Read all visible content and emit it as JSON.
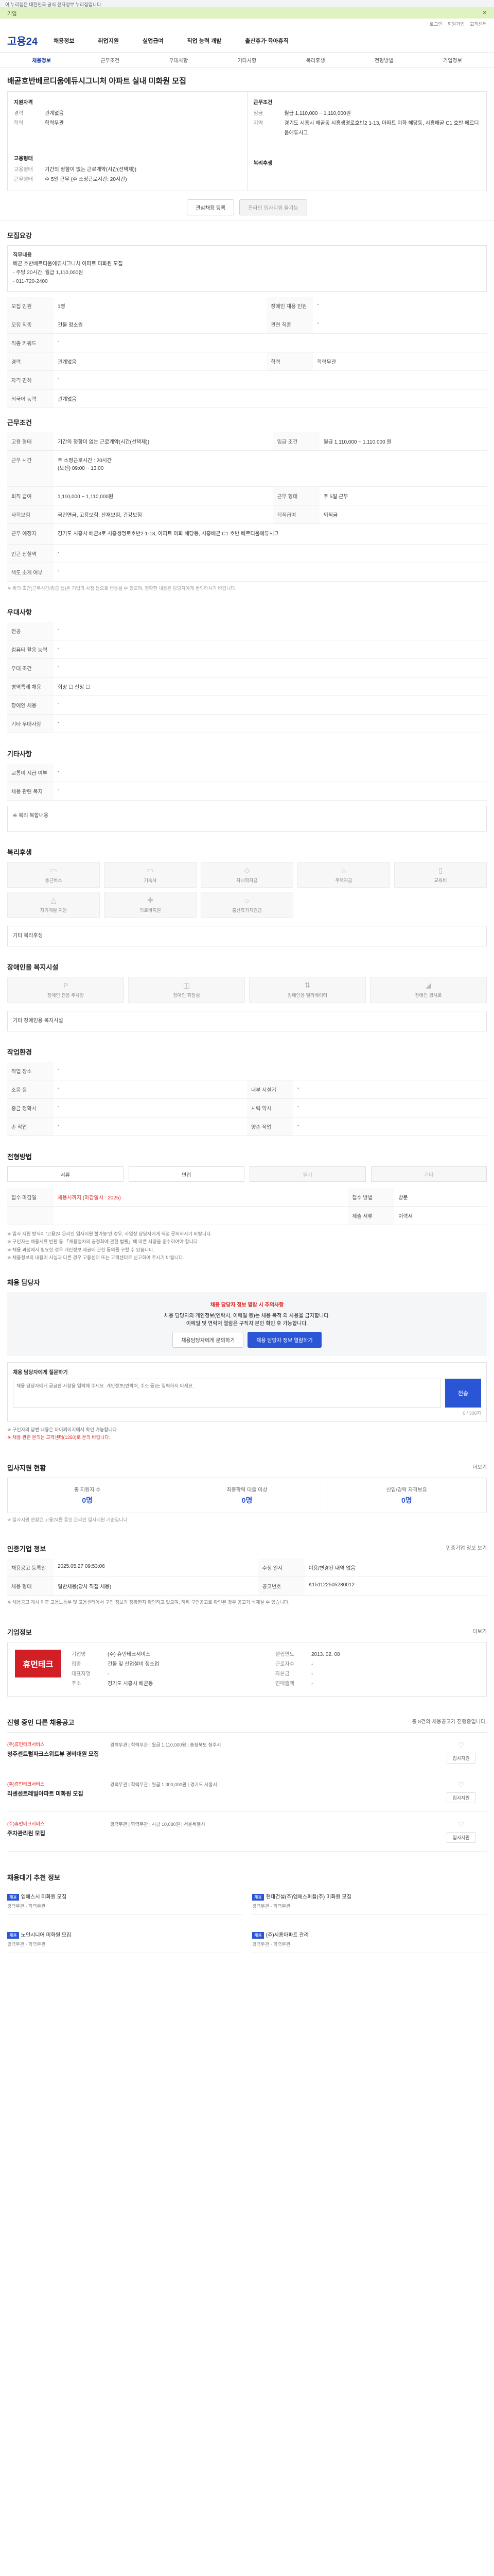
{
  "topbar": "이 누리집은 대한민국 공식 전자정부 누리집입니다.",
  "banner": {
    "text": "기업",
    "close": "✕"
  },
  "util": [
    "로그인",
    "회원가입",
    "고객센터"
  ],
  "header": {
    "logo": "고용24",
    "nav": [
      "채용정보",
      "취업지원",
      "실업급여",
      "직업 능력 개발",
      "출산휴가·육아휴직"
    ]
  },
  "subnav": [
    "채용정보",
    "근무조건",
    "우대사항",
    "기타사항",
    "복리후생",
    "전형방법",
    "기업정보"
  ],
  "job": {
    "title": "배곧호반베르디움에듀시그니처 아파트 실내 미화원 모집",
    "summary_left_title": "지원자격",
    "summary_left": [
      {
        "k": "경력",
        "v": "관계없음"
      },
      {
        "k": "학력",
        "v": "학력무관"
      }
    ],
    "summary_left2_title": "고용형태",
    "summary_left2": [
      {
        "k": "고용형태",
        "v": "기간의 정함이 없는 근로계약(시간(선택제))"
      },
      {
        "k": "근무형태",
        "v": "주 5일 근무 (주 소정근로시간: 20시간)"
      }
    ],
    "summary_right_title": "근무조건",
    "summary_right": [
      {
        "k": "임금",
        "v": "월급 1,110,000 ~ 1,110,000원"
      },
      {
        "k": "지역",
        "v": "경기도 시흥시 배곧동 시흥생명로호반2 1-13, 아파트 미화 해당동, 시흥배곧 C1 호반 베르디움에듀시그"
      },
      {
        "k": "",
        "v": ""
      }
    ],
    "summary_right2_title": "복리후생",
    "buttons": {
      "apply": "온라인 입사지원 불가능",
      "save": "관심채용 등록"
    }
  },
  "recruit": {
    "title": "모집요강",
    "desc_title": "직무내용",
    "desc": "배곧 호반베르디움에듀시그니처 아파트 미화원 모집\n- 주당 20시간, 월급 1,110,000원\n- 011-720-2400",
    "rows": [
      {
        "h": "모집 인원",
        "v": "1명",
        "h2": "장애인 채용 인원",
        "v2": "-"
      },
      {
        "h": "모집 직종",
        "v": "건물 청소원",
        "h2": "관련 직종",
        "v2": "-"
      },
      {
        "h": "직종 키워드",
        "v": "-",
        "h2": "",
        "v2": ""
      },
      {
        "h": "경력",
        "v": "관계없음",
        "h2": "학력",
        "v2": "학력무관"
      },
      {
        "h": "자격 면허",
        "v": "-",
        "h2": "",
        "v2": ""
      },
      {
        "h": "외국어 능력",
        "v": "관계없음",
        "h2": "",
        "v2": ""
      }
    ]
  },
  "conditions": {
    "title": "근무조건",
    "rows": [
      {
        "h": "고용 형태",
        "v": "기간의 정함이 없는 근로계약(시간(선택제))",
        "h2": "임금 조건",
        "v2": "월급 1,110,000 ~ 1,110,000 원"
      },
      {
        "h": "근무 시간",
        "v": "주 소정근로시간 : 20시간\n(오전) 09:00 ~ 13:00",
        "h2": "",
        "v2": ""
      },
      {
        "h": "퇴직 급여",
        "v": "1,110,000 ~ 1,110,000원",
        "h2": "근무 형태",
        "v2": "주 5일 근무"
      },
      {
        "h": "사회보험",
        "v": "국민연금, 고용보험, 산재보험, 건강보험",
        "h2": "퇴직급여",
        "v2": "퇴직금"
      },
      {
        "h": "근무 예정지",
        "v": "경기도 시흥시 배곧3로 시흥생명로호반2 1-13, 아파트 미화 해당동, 시흥배곧 C1 호반 베르디움에듀시그",
        "h2": "",
        "v2": ""
      },
      {
        "h": "인근 전철역",
        "v": "-",
        "h2": "",
        "v2": ""
      },
      {
        "h": "색도 소개 여부",
        "v": "-",
        "h2": "",
        "v2": ""
      }
    ],
    "note": "※ 위의 조건(근무시간/임금 등)은 기업의 사정 등으로 변동될 수 있으며, 정확한 내용은 담당자에게 문의하시기 바랍니다."
  },
  "preference": {
    "title": "우대사항",
    "rows": [
      {
        "h": "전공",
        "v": "-"
      },
      {
        "h": "컴퓨터 활용 능력",
        "v": "-"
      },
      {
        "h": "우대 조건",
        "v": "-"
      },
      {
        "h": "병역특례 채용",
        "v": "희망 ☐ 신청 ☐"
      },
      {
        "h": "장애인 채용",
        "v": "-"
      },
      {
        "h": "기타 우대사항",
        "v": "-"
      }
    ]
  },
  "etc": {
    "title": "기타사항",
    "rows": [
      {
        "h": "교통비 지급 여부",
        "v": "-"
      },
      {
        "h": "채용 관련 복지",
        "v": "-"
      }
    ],
    "box": "※ 복리 복합내용"
  },
  "welfare": {
    "title": "복리후생",
    "cards": [
      "통근버스",
      "기숙사",
      "자녀학자금",
      "주택자금",
      "교육비"
    ],
    "cards2": [
      "자기계발 지원",
      "의료비지원",
      "출산휴가지원금",
      "",
      ""
    ],
    "more": "기타 복리후생"
  },
  "disability": {
    "title": "장애인을 복지시설",
    "cards": [
      "장애인 전용 주차장",
      "장애인 화장실",
      "장애인용 엘리베이터",
      "장애인 경사로"
    ],
    "more": "기타 장애인용 복지시설"
  },
  "workplace": {
    "title": "작업환경",
    "rows": [
      {
        "h": "작업 장소",
        "v": "-",
        "h2": "",
        "v2": ""
      },
      {
        "h": "소음 등",
        "v": "-",
        "h2": "내부 시설기",
        "v2": "-"
      },
      {
        "h": "중금 정확시",
        "v": "-",
        "h2": "시력 약시",
        "v2": "-"
      },
      {
        "h": "손 작업",
        "v": "-",
        "h2": "양손 작업",
        "v2": "-"
      }
    ]
  },
  "method": {
    "title": "전형방법",
    "buttons": [
      "서류",
      "면접",
      "필기",
      "기타"
    ],
    "rows": [
      {
        "h": "접수 마감일",
        "v": "채용시까지 (마감일시 : 2025)",
        "h2": "접수 방법",
        "v2": "방문"
      },
      {
        "h": "",
        "v": "",
        "h2": "제출 서류",
        "v2": "이력서"
      }
    ],
    "notices": [
      "※ 입사 지원 방식이 '고용24 온라인 입사지원 불가능'인 경우, 사업장 담당자에게 직접 문의하시기 바랍니다.",
      "※ 구인자는 채용서류 반환 등 「채용절차의 공정화에 관한 법률」에 따른 사항을 준수하여야 합니다.",
      "※ 채용 과정에서 필요한 경우 개인정보 제공에 관한 동의를 구할 수 있습니다.",
      "※ 채용정보의 내용이 사실과 다른 경우 고용센터 또는 고객센터로 신고하여 주시기 바랍니다."
    ]
  },
  "contact": {
    "title": "채용 담당자",
    "warn_red": "채용 담당자 정보 열람 시 주의사항",
    "warn": "채용 담당자의 개인정보(연락처, 이메일 등)는 채용 목적 외 사용을 금지합니다.",
    "warn2": "이메일 및 연락처 열람은 구직자 본인 확인 후 가능합니다.",
    "btn1": "채용담당자에게 문의하기",
    "btn2": "채용 담당자 정보 열람하기",
    "inq_title": "채용 담당자에게 질문하기",
    "inq_placeholder": "채용 담당자에게 궁금한 사항을 입력해 주세요. 개인정보(연락처, 주소 등)는 입력하지 마세요.",
    "inq_count": "0 / 300자",
    "inq_send": "전송",
    "inq_note1": "※ 구인자의 답변 내용은 마이페이지에서 확인 가능합니다.",
    "inq_note2": "※ 채용 관련 문의는 고객센터(1350)로 문의 바랍니다."
  },
  "applicants": {
    "title": "입사지원 현황",
    "more": "더보기",
    "stats": [
      {
        "label": "총 지원자 수",
        "num": "0명"
      },
      {
        "label": "최종학력 대졸 이상",
        "num": "0명"
      },
      {
        "label": "신입/경력 자격보유",
        "num": "0명"
      }
    ],
    "note": "※ 입사지원 현황은 고용24를 통한 온라인 입사지원 기준입니다."
  },
  "history": {
    "title": "인증기업 정보",
    "btn": "인증기업 정보 보기",
    "rows": [
      {
        "h": "채용공고 등록일",
        "v": "2025.05.27 09:53:06",
        "h2": "수정 일시",
        "v2": "이용/변경된 내역 없음"
      },
      {
        "h": "채용 형태",
        "v": "일반채용(당사 직접 채용)",
        "h2": "공고번호",
        "v2": "K151122505280012"
      }
    ],
    "notice": "※ 채용공고 게시 이후 고용노동부 및 고용센터에서 구인 정보가 정확한지 확인하고 있으며, 허위 구인공고로 확인된 경우 공고가 삭제될 수 있습니다."
  },
  "company": {
    "title": "기업정보",
    "more": "더보기",
    "logo": "휴먼테크",
    "info": [
      {
        "l": "기업명",
        "v": "(주) 휴먼테크서비스"
      },
      {
        "l": "설립연도",
        "v": "2013. 02. 08"
      },
      {
        "l": "업종",
        "v": "건물 및 산업설비 청소업"
      },
      {
        "l": "근로자수",
        "v": "-"
      },
      {
        "l": "대표자명",
        "v": "-"
      },
      {
        "l": "자본금",
        "v": "-"
      },
      {
        "l": "주소",
        "v": "경기도 시흥시 배곧동"
      },
      {
        "l": "연매출액",
        "v": "-"
      }
    ]
  },
  "other_posts": {
    "title": "진행 중인 다른 채용공고",
    "sub": "총 8건의 채용공고가 진행중입니다.",
    "items": [
      {
        "co": "(주)휴먼테크서비스",
        "t": "청주센트럴파크스위트뷰 경비대원 모집",
        "m": "경력무관 | 학력무관 | 월급 1,110,000원 | 충청북도 청주시",
        "like": "♡",
        "b": "입사지원"
      },
      {
        "co": "(주)휴먼테크서비스",
        "t": "리센센트레빌아파트 미화원 모집",
        "m": "경력무관 | 학력무관 | 월급 1,300,000원 | 경기도 시흥시",
        "like": "♡",
        "b": "입사지원"
      },
      {
        "co": "(주)휴먼테크서비스",
        "t": "주차관리원 모집",
        "m": "경력무관 | 학력무관 | 시급 10,030원 | 서울특별시",
        "like": "♡",
        "b": "입사지원"
      }
    ]
  },
  "recommend": {
    "title": "채용대기 추천 정보",
    "items": [
      {
        "badge": "채용",
        "t": "엠에스시 미화원 모집",
        "m": "경력무관 · 학력무관"
      },
      {
        "badge": "채용",
        "t": "현대건설(주)엠에스퍼플(주) 미화원 모집",
        "m": "경력무관 · 학력무관"
      },
      {
        "badge": "채용",
        "t": "노인시니어 미화원 모집",
        "m": "경력무관 · 학력무관"
      },
      {
        "badge": "채용",
        "t": "(주)시흥아파트 관리",
        "m": "경력무관 · 학력무관"
      }
    ]
  }
}
